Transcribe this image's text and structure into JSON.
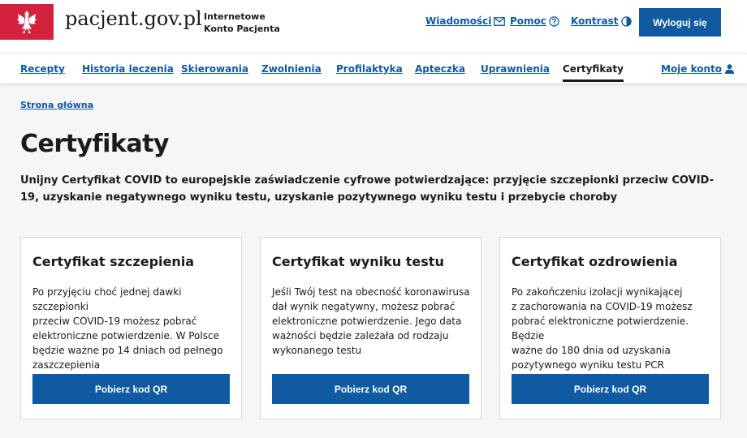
{
  "header": {
    "site_name": "pacjent.gov.pl",
    "subtitle_line1": "Internetowe",
    "subtitle_line2": "Konto Pacjenta",
    "links": {
      "messages": "Wiadomości",
      "help": "Pomoc",
      "contrast": "Kontrast"
    },
    "logout_label": "Wyloguj się",
    "emblem_color": "#d4213d",
    "icons": {
      "messages": "envelope-icon",
      "help": "question-circle-icon",
      "contrast": "contrast-icon"
    }
  },
  "nav": {
    "items": [
      "Recepty",
      "Historia leczenia",
      "Skierowania",
      "Zwolnienia",
      "Profilaktyka",
      "Apteczka",
      "Uprawnienia",
      "Certyfikaty"
    ],
    "active": "Certyfikaty",
    "account_label": "Moje konto",
    "account_icon": "user-icon"
  },
  "breadcrumb": "Strona główna",
  "page": {
    "title": "Certyfikaty",
    "description": "Unijny Certyfikat COVID to europejskie zaświadczenie cyfrowe potwierdzające: przyjęcie szczepionki przeciw COVID-19, uzyskanie negatywnego wyniku testu, uzyskanie pozytywnego wyniku testu i przebycie choroby"
  },
  "cards": [
    {
      "title": "Certyfikat szczepienia",
      "text_lines": [
        "Po przyjęciu choć jednej dawki szczepionki",
        "przeciw COVID-19 możesz pobrać",
        "elektroniczne potwierdzenie. W Polsce",
        "będzie ważne po 14 dniach od pełnego",
        "zaszczepienia"
      ],
      "button": "Pobierz kod QR"
    },
    {
      "title": "Certyfikat wyniku testu",
      "text_lines": [
        "Jeśli Twój test na obecność koronawirusa",
        "dał wynik negatywny, możesz pobrać",
        "elektroniczne potwierdzenie. Jego data",
        "ważności będzie zależała od rodzaju",
        "wykonanego testu"
      ],
      "button": "Pobierz kod QR"
    },
    {
      "title": "Certyfikat ozdrowienia",
      "text_lines": [
        "Po zakończeniu izolacji wynikającej",
        "z zachorowania na COVID-19 możesz",
        "pobrać elektroniczne potwierdzenie. Będzie",
        "ważne do 180 dnia od uzyskania",
        "pozytywnego wyniku testu PCR"
      ],
      "button": "Pobierz kod QR"
    }
  ],
  "colors": {
    "accent": "#0f5aa1",
    "text": "#1b1b1b",
    "background": "#f6f6f6"
  }
}
